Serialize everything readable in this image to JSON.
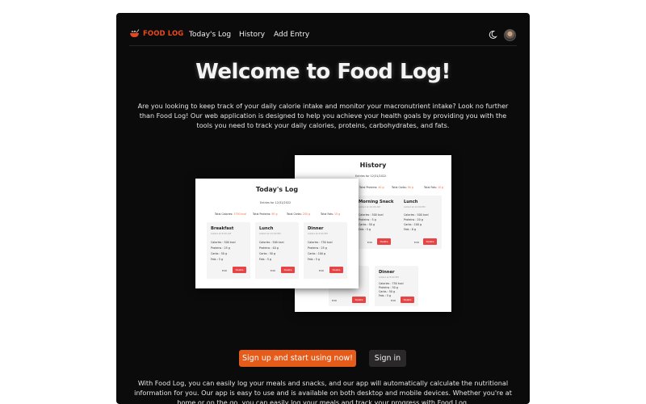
{
  "nav": {
    "brand": "FOOD LOG",
    "links": [
      "Today's Log",
      "History",
      "Add Entry"
    ],
    "icons": [
      "bowl-icon",
      "moon-icon",
      "avatar"
    ]
  },
  "hero": {
    "title": "Welcome to Food Log!",
    "intro": "Are you looking to keep track of your daily calorie intake and monitor your macronutrient intake? Look no further than Food Log! Our web application is designed to help you achieve your health goals by providing you with the tools you need to track your daily calories, proteins, carbohydrates, and fats."
  },
  "preview_history": {
    "title": "History",
    "subtitle": "Entries for 12/31/2022",
    "totals": [
      {
        "label": "Total Proteins:",
        "value": "40 g"
      },
      {
        "label": "Total Carbs:",
        "value": "90 g"
      },
      {
        "label": "Total Fats:",
        "value": "10 g"
      }
    ],
    "cards": [
      {
        "name": "Morning Snack",
        "time": "Added at 10:00 AM",
        "lines": [
          "Calories : 500 kcal",
          "Proteins : 5 g",
          "Carbs : 50 g",
          "Fats : 5 g"
        ]
      },
      {
        "name": "Lunch",
        "time": "Added at 12:00 PM",
        "lines": [
          "Calories : 500 kcal",
          "Proteins : 20 g",
          "Carbs : 100 g",
          "Fats : 8 g"
        ]
      },
      {
        "name": "Dinner",
        "time": "Added at 8:00 PM",
        "lines": [
          "Calories : 750 kcal",
          "Proteins : 30 g",
          "Carbs : 50 g",
          "Fats : 5 g"
        ]
      }
    ],
    "edit_label": "Edit",
    "delete_label": "Delete"
  },
  "preview_today": {
    "title": "Today's Log",
    "subtitle": "Entries for 12/31/2022",
    "totals": [
      {
        "label": "Total Calories:",
        "value": "1750 kcal"
      },
      {
        "label": "Total Proteins:",
        "value": "90 g"
      },
      {
        "label": "Total Carbs:",
        "value": "200 g"
      },
      {
        "label": "Total Fats:",
        "value": "15 g"
      }
    ],
    "cards": [
      {
        "name": "Breakfast",
        "time": "Added at 8:00 AM",
        "lines": [
          "Calories : 500 kcal",
          "Proteins : 25 g",
          "Carbs : 50 g",
          "Fats : 5 g"
        ]
      },
      {
        "name": "Lunch",
        "time": "Added at 12:00 PM",
        "lines": [
          "Calories : 500 kcal",
          "Proteins : 40 g",
          "Carbs : 50 g",
          "Fats : 5 g"
        ]
      },
      {
        "name": "Dinner",
        "time": "Added at 6:00 PM",
        "lines": [
          "Calories : 750 kcal",
          "Proteins : 25 g",
          "Carbs : 100 g",
          "Fats : 5 g"
        ]
      }
    ],
    "edit_label": "Edit",
    "delete_label": "Delete"
  },
  "cta": {
    "primary": "Sign up and start using now!",
    "secondary": "Sign in"
  },
  "outro": "With Food Log, you can easily log your meals and snacks, and our app will automatically calculate the nutritional information for you. Our app is easy to use and is available on both desktop and mobile devices. Whether you're at home or on the go, you can easily log your meals and track your progress with Food Log.",
  "colors": {
    "accent": "#e55b1a",
    "background": "#0c0b0b",
    "delete": "#e74545"
  }
}
